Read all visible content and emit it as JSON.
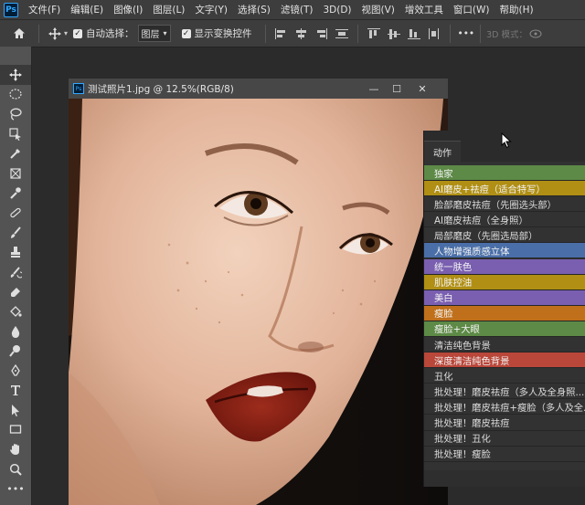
{
  "menu": {
    "logo": "Ps",
    "items": [
      "文件(F)",
      "编辑(E)",
      "图像(I)",
      "图层(L)",
      "文字(Y)",
      "选择(S)",
      "滤镜(T)",
      "3D(D)",
      "视图(V)",
      "增效工具",
      "窗口(W)",
      "帮助(H)"
    ]
  },
  "options": {
    "auto_select_label": "自动选择：",
    "auto_select_value": "图层",
    "show_transform_label": "显示变换控件",
    "more": "•••",
    "mode_3d": "3D 模式："
  },
  "document": {
    "title": "测试照片1.jpg @ 12.5%(RGB/8)",
    "minimize": "—",
    "maximize": "☐",
    "close": "✕"
  },
  "actions_panel": {
    "tab": "动作",
    "items": [
      {
        "label": "独家",
        "color": "#5d8a46"
      },
      {
        "label": "AI磨皮+祛痘（适合特写）",
        "color": "#b08f14"
      },
      {
        "label": "脸部磨皮祛痘（先圈选头部）",
        "color": ""
      },
      {
        "label": "AI磨皮祛痘（全身照）",
        "color": ""
      },
      {
        "label": "局部磨皮（先圈选局部）",
        "color": ""
      },
      {
        "label": "人物增强质感立体",
        "color": "#4a6fa8"
      },
      {
        "label": "统一肤色",
        "color": "#7a5fb0"
      },
      {
        "label": "肌肤控油",
        "color": "#b08f14"
      },
      {
        "label": "美白",
        "color": "#7a5fb0"
      },
      {
        "label": "瘦脸",
        "color": "#c0701a"
      },
      {
        "label": "瘦脸+大眼",
        "color": "#5d8a46"
      },
      {
        "label": "清洁纯色背景",
        "color": ""
      },
      {
        "label": "深度清洁纯色背景",
        "color": "#b9473a"
      },
      {
        "label": "丑化",
        "color": ""
      },
      {
        "label": "批处理！磨皮祛痘（多人及全身照...",
        "color": ""
      },
      {
        "label": "批处理！磨皮祛痘+瘦脸（多人及全...",
        "color": ""
      },
      {
        "label": "批处理！磨皮祛痘",
        "color": ""
      },
      {
        "label": "批处理！丑化",
        "color": ""
      },
      {
        "label": "批处理！瘦脸",
        "color": ""
      }
    ]
  },
  "colors": {
    "ui_dark": "#2b2b2b",
    "panel": "#323232",
    "menubar": "#3d3d3d",
    "toolbar": "#535353"
  },
  "tools": [
    "move-icon",
    "marquee-icon",
    "lasso-icon",
    "object-select-icon",
    "crop-icon",
    "frame-icon",
    "eyedropper-icon",
    "healing-brush-icon",
    "brush-icon",
    "clone-stamp-icon",
    "history-brush-icon",
    "eraser-icon",
    "paint-bucket-icon",
    "blur-icon",
    "dodge-icon",
    "pen-icon",
    "type-icon",
    "path-select-icon",
    "rectangle-icon",
    "hand-icon",
    "zoom-icon",
    "more-tools-icon"
  ]
}
